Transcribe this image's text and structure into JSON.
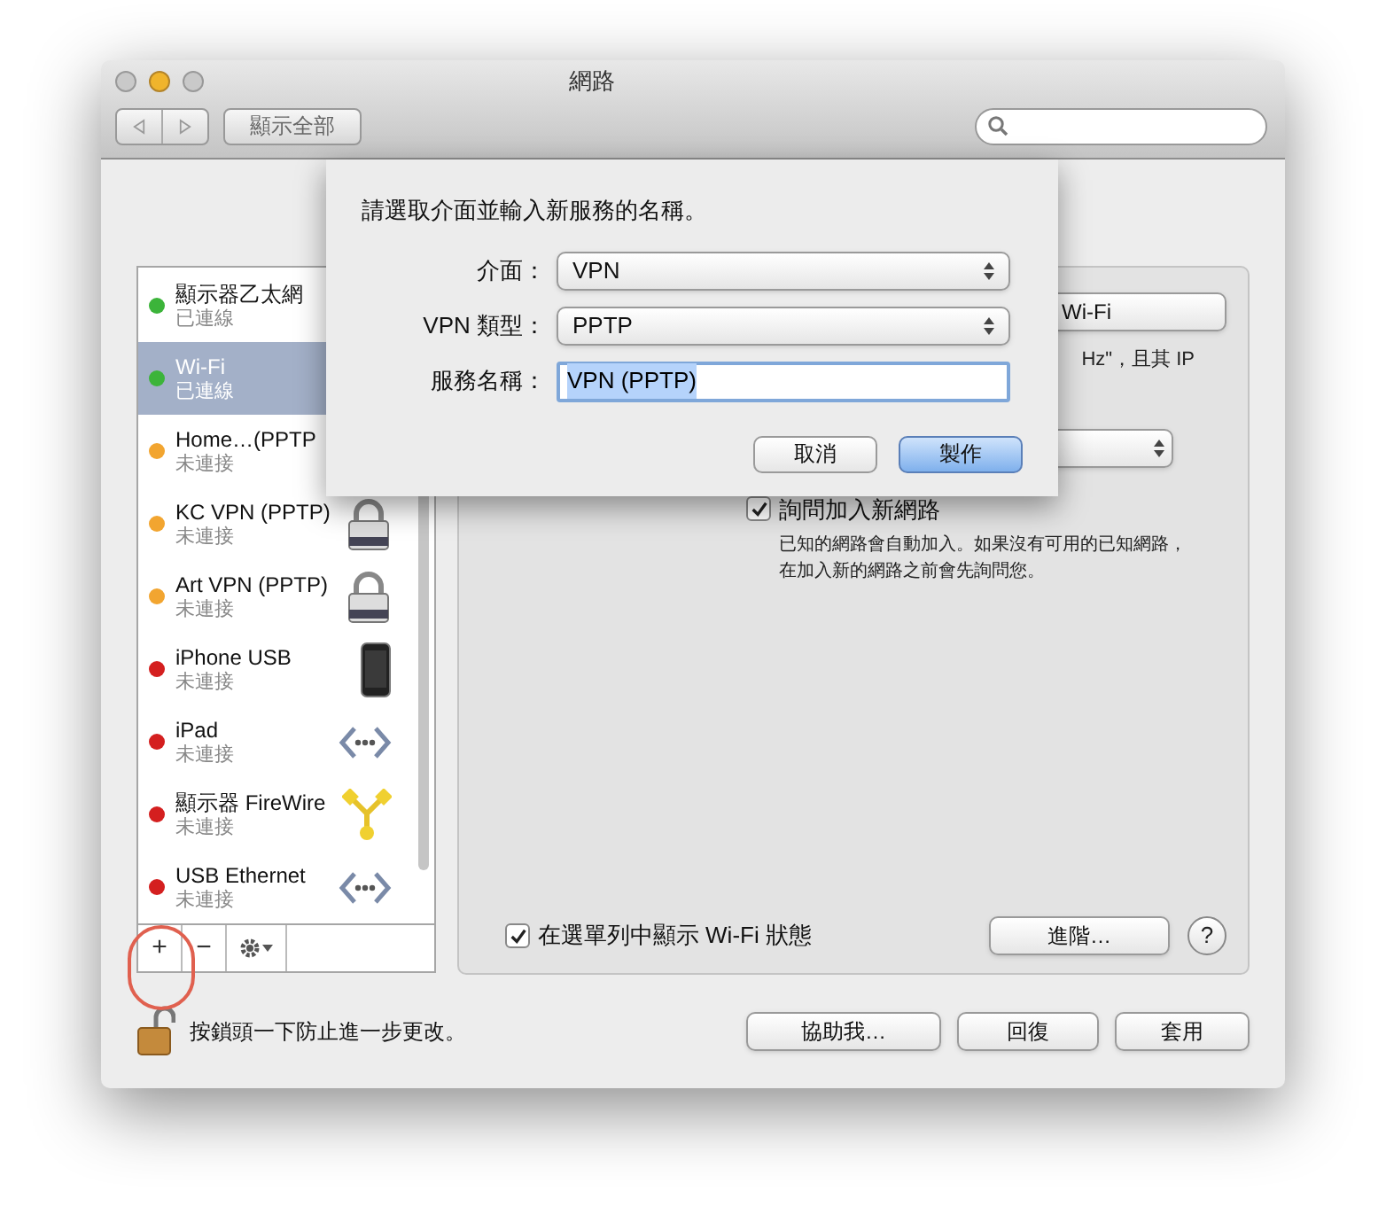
{
  "window": {
    "title": "網路"
  },
  "toolbar": {
    "show_all_button": "顯示全部"
  },
  "sheet": {
    "prompt": "請選取介面並輸入新服務的名稱。",
    "fields": [
      {
        "kind": "select",
        "label": "介面：",
        "value": "VPN"
      },
      {
        "kind": "select",
        "label": "VPN 類型：",
        "value": "PPTP"
      },
      {
        "kind": "text",
        "label": "服務名稱：",
        "value": "VPN (PPTP)"
      }
    ],
    "buttons": [
      {
        "label": "取消",
        "default": false
      },
      {
        "label": "製作",
        "default": true
      }
    ]
  },
  "services": [
    {
      "name": "顯示器乙太網",
      "status": "已連線",
      "color": "#3cb43a",
      "selected": false
    },
    {
      "name": "Wi-Fi",
      "status": "已連線",
      "color": "#3cb43a",
      "selected": true
    },
    {
      "name": "Home…(PPTP",
      "status": "未連接",
      "color": "#f2a530",
      "selected": false
    },
    {
      "name": "KC VPN (PPTP)",
      "status": "未連接",
      "color": "#f2a530",
      "selected": false,
      "kind": "lock"
    },
    {
      "name": "Art VPN (PPTP)",
      "status": "未連接",
      "color": "#f2a530",
      "selected": false,
      "kind": "lock"
    },
    {
      "name": "iPhone USB",
      "status": "未連接",
      "color": "#d41f1f",
      "selected": false,
      "kind": "phone"
    },
    {
      "name": "iPad",
      "status": "未連接",
      "color": "#d41f1f",
      "selected": false,
      "kind": "arrows"
    },
    {
      "name": "顯示器 FireWire",
      "status": "未連接",
      "color": "#d41f1f",
      "selected": false,
      "kind": "firewire"
    },
    {
      "name": "USB Ethernet",
      "status": "未連接",
      "color": "#d41f1f",
      "selected": false,
      "kind": "arrows"
    }
  ],
  "list_controls": {
    "add": "+",
    "remove": "−"
  },
  "panel": {
    "wifi_button": "Wi-Fi",
    "note_fragment": "Hz\"，且其 IP",
    "ask_join": {
      "label": "詢問加入新網路",
      "checked": true,
      "description": "已知的網路會自動加入。如果沒有可用的已知網路，在加入新的網路之前會先詢問您。"
    },
    "show_in_menu": {
      "label": "在選單列中顯示 Wi-Fi 狀態",
      "checked": true
    },
    "advanced_button": "進階…",
    "help_button": "?"
  },
  "lock_text": "按鎖頭一下防止進一步更改。",
  "footer_buttons": [
    "協助我…",
    "回復",
    "套用"
  ]
}
